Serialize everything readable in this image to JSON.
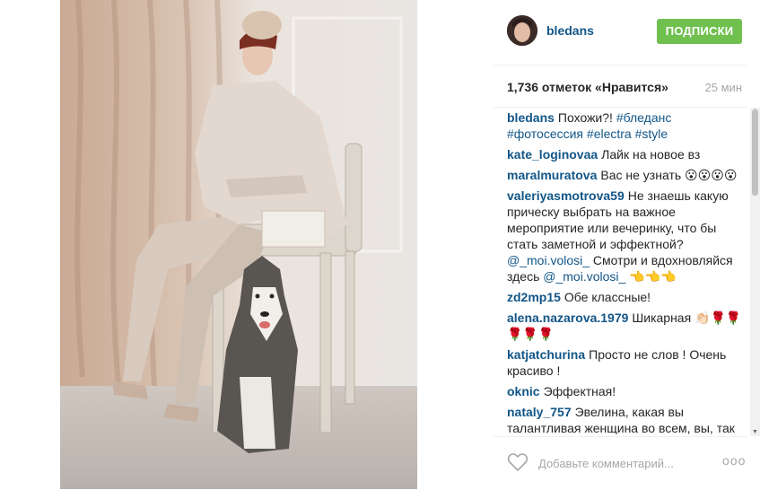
{
  "post": {
    "username": "bledans",
    "follow_label": "ПОДПИСКИ",
    "likes_text": "1,736 отметок «Нравится»",
    "time_ago": "25 мин"
  },
  "comments": [
    {
      "user": "bledans",
      "text": "Похожи?!",
      "tags": "#бледанс #фотосессия #electra #style"
    },
    {
      "user": "kate_loginovaa",
      "text": "Лайк на новое вз",
      "tags": ""
    },
    {
      "user": "maralmuratova",
      "text": "Вас не узнать 😮😮😮😮",
      "tags": ""
    },
    {
      "user": "valeriyasmotrova59",
      "text": "Не знаешь какую прическу выбрать на важное мероприятие или вечеринку, что бы стать заметной и эффектной?",
      "tags": "@_moi.volosi_",
      "text2": "Смотри и вдохновляйся здесь",
      "tags2": "@_moi.volosi_",
      "text3": "👈👈👈"
    },
    {
      "user": "zd2mp15",
      "text": "Обе классные!",
      "tags": ""
    },
    {
      "user": "alena.nazarova.1979",
      "text": "Шикарная 👏🏻🌹🌹🌹🌹🌹",
      "tags": ""
    },
    {
      "user": "katjatchurina",
      "text": "Просто не слов ! Очень красиво !",
      "tags": ""
    },
    {
      "user": "oknic",
      "text": "Эффектная!",
      "tags": ""
    },
    {
      "user": "nataly_757",
      "text": "Эвелина, какая вы талантливая женщина во всем, вы, так много работаете, такие впечатление",
      "tags": ""
    }
  ],
  "footer": {
    "comment_placeholder": "Добавьте комментарий...",
    "more_label": "ooo"
  },
  "colors": {
    "username_blue": "#125688",
    "follow_green": "#70c050",
    "muted_gray": "#a5a7aa"
  },
  "icons": {
    "like": "heart-icon",
    "more": "more-options-icon"
  }
}
